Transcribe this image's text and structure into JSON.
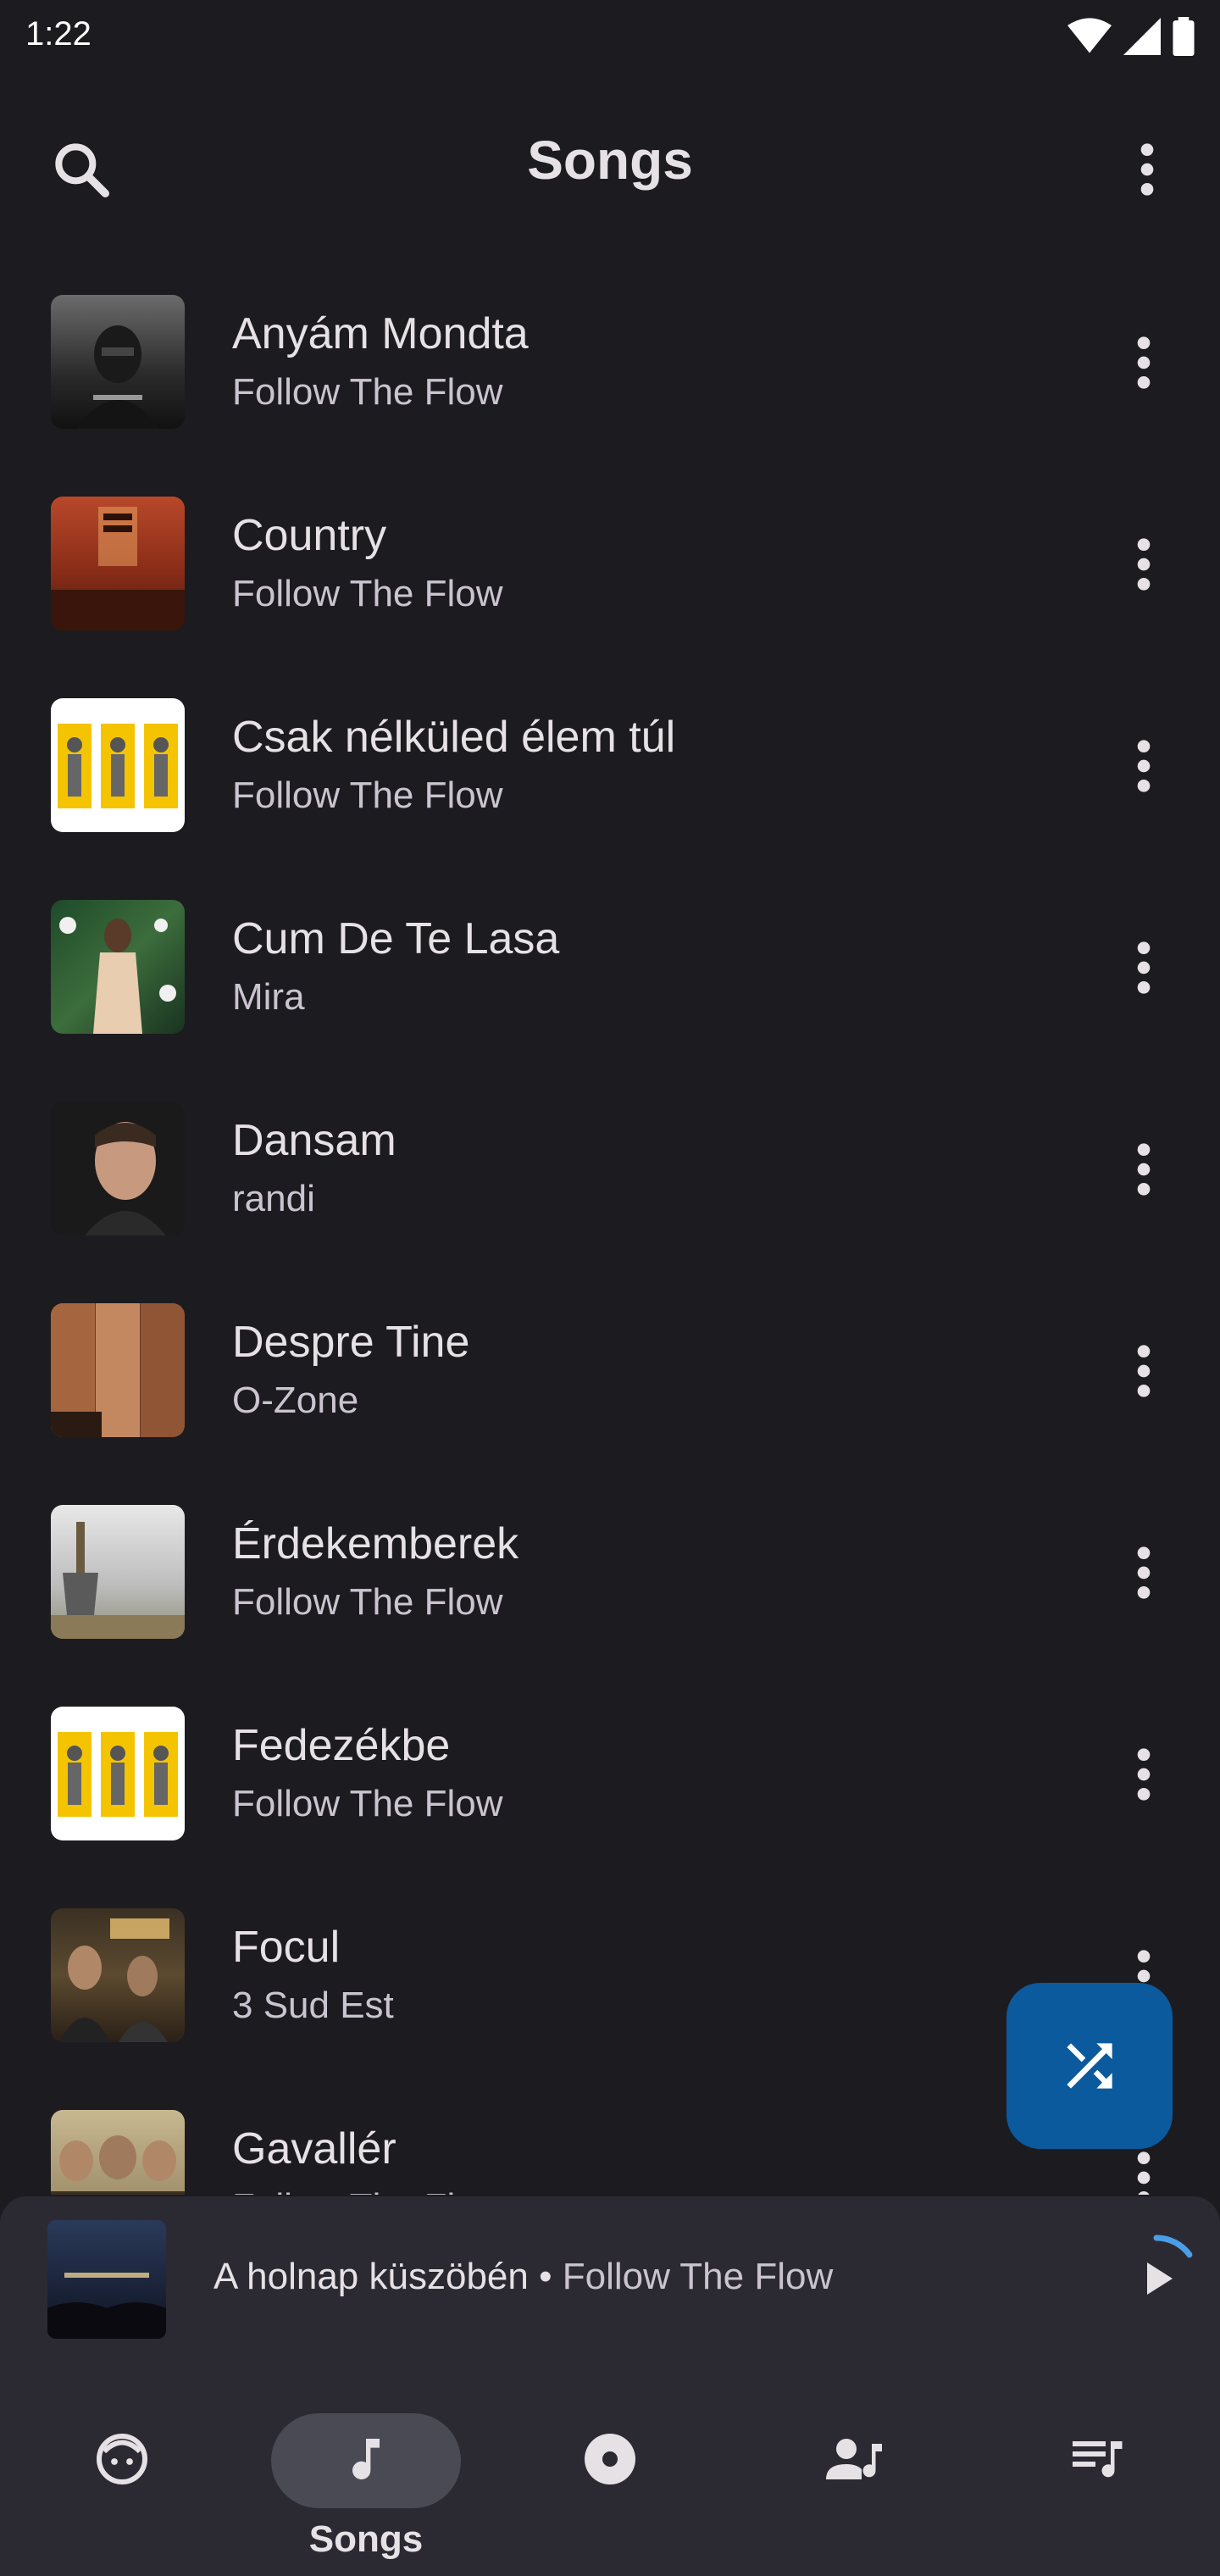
{
  "status_bar": {
    "time": "1:22"
  },
  "header": {
    "title": "Songs"
  },
  "songs": [
    {
      "title": "Anyám Mondta",
      "artist": "Follow The Flow"
    },
    {
      "title": "Country",
      "artist": "Follow The Flow"
    },
    {
      "title": "Csak nélküled élem túl",
      "artist": "Follow The Flow"
    },
    {
      "title": "Cum De Te Lasa",
      "artist": "Mira"
    },
    {
      "title": "Dansam",
      "artist": "randi"
    },
    {
      "title": "Despre Tine",
      "artist": "O-Zone"
    },
    {
      "title": "Érdekemberek",
      "artist": "Follow The Flow"
    },
    {
      "title": "Fedezékbe",
      "artist": "Follow The Flow"
    },
    {
      "title": "Focul",
      "artist": "3 Sud Est"
    },
    {
      "title": "Gavallér",
      "artist": "Follow The Flow"
    }
  ],
  "mini_player": {
    "title": "A holnap küszöbén",
    "separator": " • ",
    "artist": "Follow The Flow",
    "progress": 0.15
  },
  "bottom_nav": {
    "items": [
      {
        "icon": "for-you-icon",
        "label": ""
      },
      {
        "icon": "music-note-icon",
        "label": "Songs",
        "active": true
      },
      {
        "icon": "album-icon",
        "label": ""
      },
      {
        "icon": "artist-icon",
        "label": ""
      },
      {
        "icon": "playlist-icon",
        "label": ""
      }
    ]
  },
  "colors": {
    "background": "#1c1b1f",
    "surface": "#2b2a33",
    "fab": "#0b5a9e",
    "progress_accent": "#4a9ee8"
  }
}
